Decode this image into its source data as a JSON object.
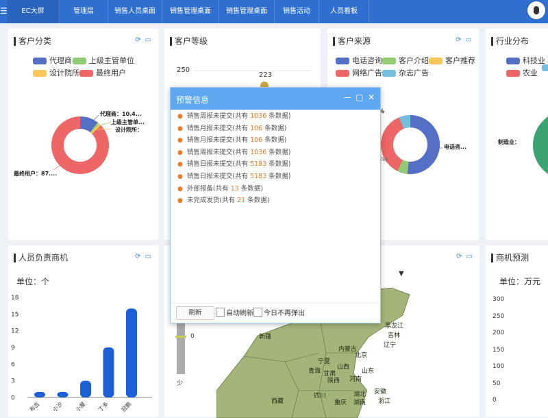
{
  "nav": {
    "menu_icon": "☰",
    "tabs": [
      "EC大屏",
      "管理层",
      "销售人员桌面",
      "销售管理桌面",
      "销售管理桌面",
      "销售活动",
      "人员看板"
    ]
  },
  "cards": {
    "customer_category": {
      "title": "客户分类",
      "legend": [
        "代理商",
        "上级主管单位",
        "设计院所",
        "最终用户"
      ],
      "labels": [
        "代理商：10.4...",
        "上级主管单...",
        "设计院所：",
        "最终用户：87...."
      ],
      "colors": [
        "#5470c6",
        "#91cc75",
        "#fac858",
        "#ee6666"
      ]
    },
    "customer_level": {
      "title": "客户等级",
      "y_tick": "250",
      "value": "223",
      "slider_value": "0",
      "slider_label": "少"
    },
    "customer_source": {
      "title": "客户来源",
      "legend": [
        "电话咨询",
        "客户介绍",
        "客户推荐",
        "网络广告",
        "杂志广告"
      ],
      "labels": [
        "%",
        "电话咨...",
        "%)"
      ],
      "colors": [
        "#5470c6",
        "#91cc75",
        "#fac858",
        "#ee6666",
        "#73c0de"
      ]
    },
    "industry": {
      "title": "行业分布",
      "legend": [
        "科技业",
        "农业"
      ],
      "labels": [
        "制造业："
      ],
      "colors": [
        "#5470c6",
        "#ee6666"
      ]
    },
    "staff_opportunity": {
      "title": "人员负责商机",
      "unit": "单位：个",
      "y_ticks": [
        "18",
        "15",
        "12",
        "9",
        "6",
        "3",
        "0"
      ],
      "x_labels": [
        "布吉",
        "小沙",
        "小屋",
        "丁多",
        "冠鹏"
      ]
    },
    "map": {
      "regions": [
        "黑龙江",
        "吉林",
        "辽宁",
        "新疆",
        "内蒙古",
        "北京",
        "宁夏",
        "山西",
        "山东",
        "青海",
        "甘肃",
        "陕西",
        "河南",
        "西藏",
        "四川",
        "湖北",
        "安徽",
        "重庆",
        "湖南",
        "浙江"
      ]
    },
    "forecast": {
      "title": "商机预测",
      "unit": "单位：万元",
      "y_ticks": [
        "300",
        "250",
        "200",
        "150",
        "100",
        "50",
        "0"
      ]
    }
  },
  "chart_data": {
    "type": "bar",
    "title": "人员负责商机",
    "ylabel": "单位：个",
    "categories": [
      "布吉",
      "小沙",
      "小屋",
      "丁多",
      "冠鹏"
    ],
    "values": [
      1,
      1,
      3,
      9,
      16
    ],
    "ylim": [
      0,
      18
    ]
  },
  "modal": {
    "title": "预警信息",
    "items": [
      {
        "pre": "销售周报未提交(共有 ",
        "num": "1036",
        "post": " 条数据)"
      },
      {
        "pre": "销售月报未提交(共有 ",
        "num": "106",
        "post": " 条数据)"
      },
      {
        "pre": "销售月报未提交(共有 ",
        "num": "106",
        "post": " 条数据)"
      },
      {
        "pre": "销售周报未提交(共有 ",
        "num": "1036",
        "post": " 条数据)"
      },
      {
        "pre": "销售日报未提交(共有 ",
        "num": "5183",
        "post": " 条数据)"
      },
      {
        "pre": "销售日报未提交(共有 ",
        "num": "5183",
        "post": " 条数据)"
      },
      {
        "pre": "外部报备(共有 ",
        "num": "13",
        "post": " 条数据)"
      },
      {
        "pre": "未完成发货(共有 ",
        "num": "21",
        "post": " 条数据)"
      }
    ],
    "refresh_label": "刷新",
    "auto_refresh_label": "自动刷新",
    "no_popup_label": "今日不再弹出"
  },
  "colors": {
    "nav": "#2f6fcf",
    "bar": "#1c5fd6",
    "map": "#a5b57a",
    "accent": "#ee7b2c"
  }
}
